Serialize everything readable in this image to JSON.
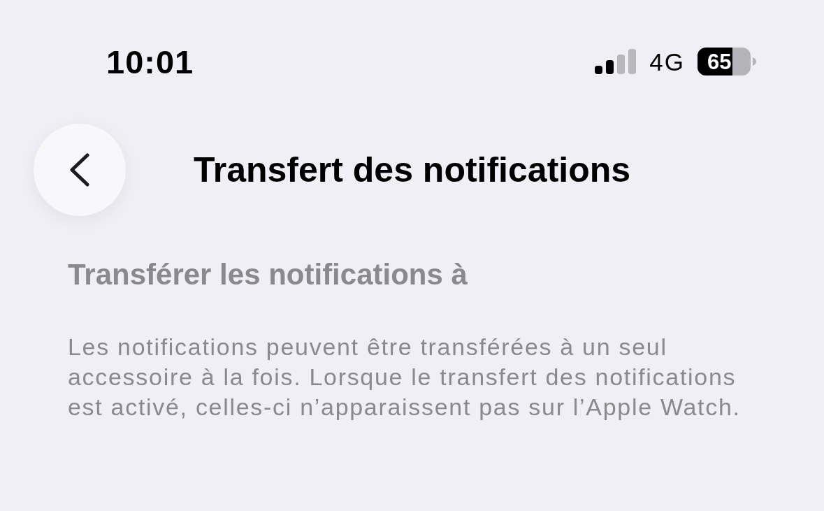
{
  "status_bar": {
    "time": "10:01",
    "network": "4G",
    "battery": "65"
  },
  "nav": {
    "title": "Transfert des notifications"
  },
  "section": {
    "header": "Transférer les notifications à",
    "footer": "Les notifications peuvent être transférées à un seul accessoire à la fois. Lorsque le transfert des notifications est activé, celles-ci n’apparaissent pas sur l’Apple Watch."
  }
}
